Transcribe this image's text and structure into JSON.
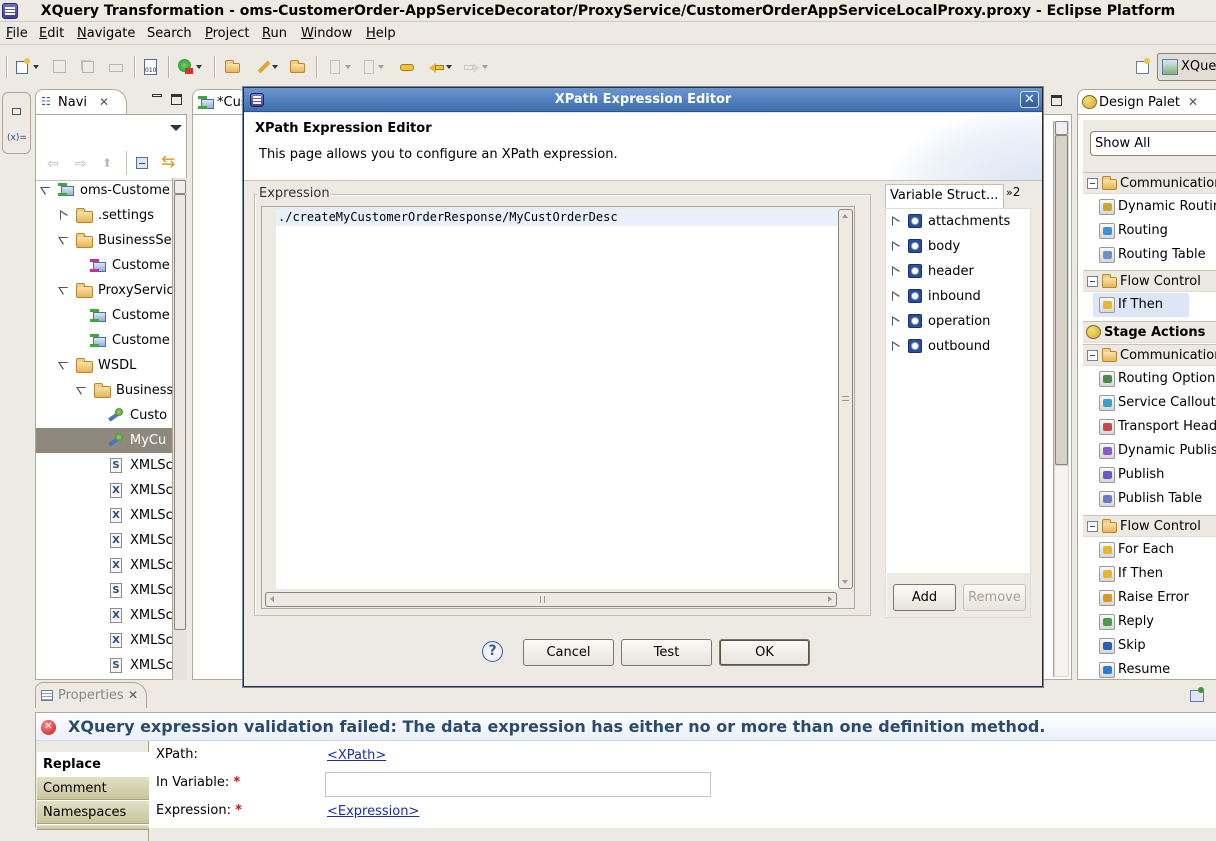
{
  "window": {
    "title": "XQuery Transformation - oms-CustomerOrder-AppServiceDecorator/ProxyService/CustomerOrderAppServiceLocalProxy.proxy - Eclipse Platform"
  },
  "menubar": {
    "items": [
      {
        "label": "File",
        "mnemonic": "F",
        "rest": "ile"
      },
      {
        "label": "Edit",
        "mnemonic": "E",
        "rest": "dit"
      },
      {
        "label": "Navigate",
        "mnemonic": "N",
        "rest": "avigate"
      },
      {
        "label": "Search",
        "mnemonic": "",
        "rest": "Search"
      },
      {
        "label": "Project",
        "mnemonic": "P",
        "rest": "roject"
      },
      {
        "label": "Run",
        "mnemonic": "R",
        "rest": "un"
      },
      {
        "label": "Window",
        "mnemonic": "W",
        "rest": "indow"
      },
      {
        "label": "Help",
        "mnemonic": "H",
        "rest": "elp"
      }
    ]
  },
  "perspective": {
    "label": "XQue"
  },
  "navigator": {
    "tab_label": "Navi",
    "tree": [
      {
        "label": "oms-Custome",
        "type": "project",
        "expanded": true
      },
      {
        "label": ".settings",
        "type": "folder",
        "expanded": false
      },
      {
        "label": "BusinessSe",
        "type": "folder",
        "expanded": true
      },
      {
        "label": "Custome",
        "type": "business-service"
      },
      {
        "label": "ProxyServic",
        "type": "folder",
        "expanded": true
      },
      {
        "label": "Custome",
        "type": "proxy-service"
      },
      {
        "label": "Custome",
        "type": "proxy-service"
      },
      {
        "label": "WSDL",
        "type": "folder",
        "expanded": true
      },
      {
        "label": "Business",
        "type": "folder",
        "expanded": true
      },
      {
        "label": "Custo",
        "type": "wsdl"
      },
      {
        "label": "MyCu",
        "type": "wsdl",
        "selected": true
      },
      {
        "label": "XMLSc",
        "type": "xsd-s"
      },
      {
        "label": "XMLSc",
        "type": "xsd-x"
      },
      {
        "label": "XMLSc",
        "type": "xsd-x"
      },
      {
        "label": "XMLSc",
        "type": "xsd-x"
      },
      {
        "label": "XMLSc",
        "type": "xsd-x"
      },
      {
        "label": "XMLSc",
        "type": "xsd-s"
      },
      {
        "label": "XMLSc",
        "type": "xsd-x"
      },
      {
        "label": "XMLSc",
        "type": "xsd-x"
      },
      {
        "label": "XMLSc",
        "type": "xsd-s"
      }
    ]
  },
  "editor": {
    "tab_label": "*Cus"
  },
  "dialog": {
    "title": "XPath Expression Editor",
    "header_title": "XPath Expression Editor",
    "header_desc": "This page allows you to configure an XPath expression.",
    "expression_group": "Expression",
    "expression_value": "./createMyCustomerOrderResponse/MyCustOrderDesc",
    "var_tab_label": "Variable Struct...",
    "var_tab_overflow": "2",
    "variables": [
      "attachments",
      "body",
      "header",
      "inbound",
      "operation",
      "outbound"
    ],
    "add_label": "Add",
    "remove_label": "Remove",
    "cancel_label": "Cancel",
    "test_label": "Test",
    "ok_label": "OK"
  },
  "palette": {
    "tab_label": "Design Palet",
    "filter_value": "Show All",
    "sections": [
      {
        "label": "Communication",
        "items": [
          "Dynamic Routing",
          "Routing",
          "Routing Table"
        ]
      },
      {
        "label": "Flow Control",
        "items": [
          "If Then"
        ]
      }
    ],
    "stage_actions_label": "Stage Actions",
    "stage_sections": [
      {
        "label": "Communication",
        "items": [
          "Routing Options",
          "Service Callout",
          "Transport Headers",
          "Dynamic Publish",
          "Publish",
          "Publish Table"
        ]
      },
      {
        "label": "Flow Control",
        "items": [
          "For Each",
          "If Then",
          "Raise Error",
          "Reply",
          "Skip",
          "Resume"
        ]
      }
    ]
  },
  "properties": {
    "tab_label": "Properties",
    "error_message": "XQuery expression validation failed: The data expression has either no or more than one definition method.",
    "tabs": [
      "Replace",
      "Comment",
      "Namespaces"
    ],
    "active_tab": "Replace",
    "xpath_label": "XPath:",
    "xpath_link": "<XPath>",
    "in_variable_label": "In Variable:",
    "in_variable_value": "",
    "expression_label": "Expression:",
    "expression_link": "<Expression>",
    "required_marker": "*"
  }
}
